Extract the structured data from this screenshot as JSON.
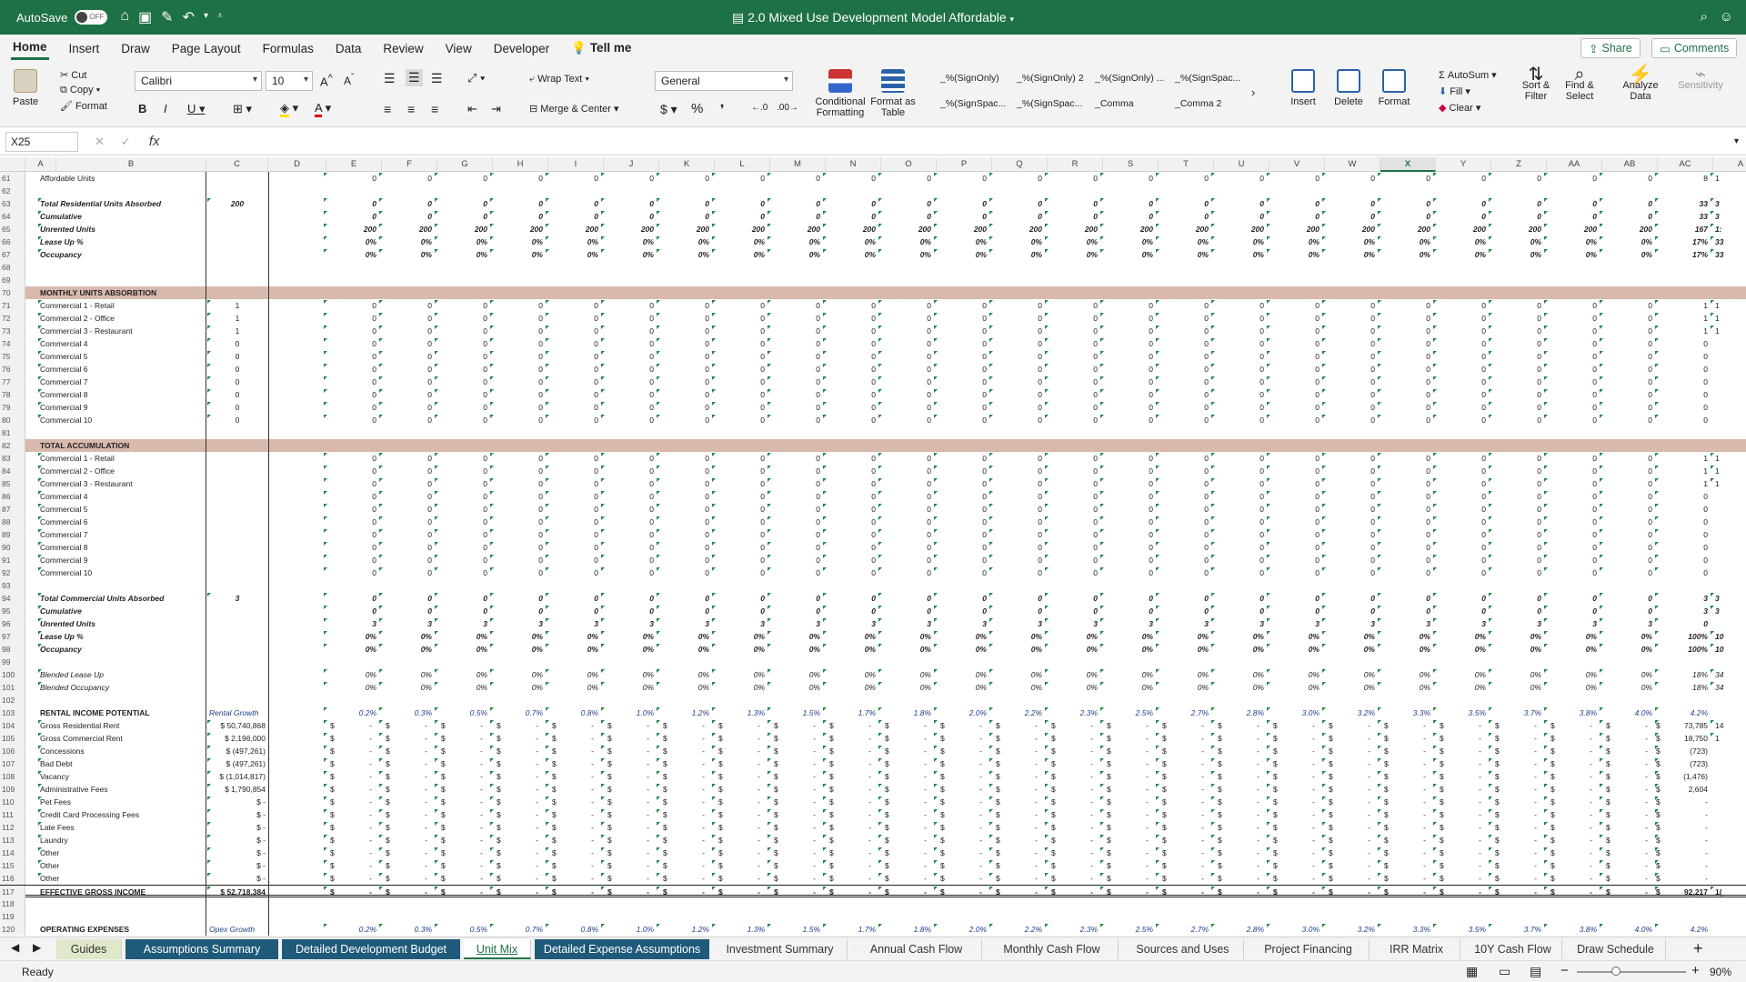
{
  "titlebar": {
    "autosave": "AutoSave",
    "autosave_state": "OFF",
    "title": "2.0 Mixed Use Development Model Affordable"
  },
  "ribbon_tabs": [
    "Home",
    "Insert",
    "Draw",
    "Page Layout",
    "Formulas",
    "Data",
    "Review",
    "View",
    "Developer"
  ],
  "tell_me": "Tell me",
  "share_label": "Share",
  "comments_label": "Comments",
  "ribbon": {
    "paste": "Paste",
    "cut": "Cut",
    "copy": "Copy",
    "format": "Format",
    "font_name": "Calibri",
    "font_size": "10",
    "wrap_text": "Wrap Text",
    "merge_center": "Merge & Center",
    "number_format": "General",
    "conditional_formatting": "Conditional Formatting",
    "format_as_table": "Format as Table",
    "styles": [
      "_%(SignOnly)",
      "_%(SignOnly) 2",
      "_%(SignOnly) ...",
      "_%(SignSpac...",
      "_%(SignSpac...",
      "_%(SignSpac...",
      "_Comma",
      "_Comma 2"
    ],
    "insert": "Insert",
    "delete": "Delete",
    "format_cells": "Format",
    "autosum": "AutoSum",
    "fill": "Fill",
    "clear": "Clear",
    "sort_filter": "Sort & Filter",
    "find_select": "Find & Select",
    "analyze_data": "Analyze Data",
    "sensitivity": "Sensitivity"
  },
  "formula_bar": {
    "name_box": "X25",
    "fx": "fx",
    "content": ""
  },
  "columns": [
    "A",
    "B",
    "C",
    "D",
    "E",
    "F",
    "G",
    "H",
    "I",
    "J",
    "K",
    "L",
    "M",
    "N",
    "O",
    "P",
    "Q",
    "R",
    "S",
    "T",
    "U",
    "V",
    "W",
    "X",
    "Y",
    "Z",
    "AA",
    "AB",
    "AC",
    "A"
  ],
  "selected_column": "X",
  "rows": [
    {
      "n": "61",
      "label": "Affordable Units",
      "c": "",
      "style": "",
      "vals": "0",
      "last": "8"
    },
    {
      "n": "62",
      "label": "",
      "c": "",
      "style": "",
      "vals": "",
      "last": ""
    },
    {
      "n": "63",
      "label": "Total Residential Units Absorbed",
      "c": "200",
      "style": "bi",
      "vals": "0",
      "last": "33"
    },
    {
      "n": "64",
      "label": "Cumulative",
      "c": "",
      "style": "bi",
      "vals": "0",
      "last": "33"
    },
    {
      "n": "65",
      "label": "Unrented Units",
      "c": "",
      "style": "bi",
      "vals": "200",
      "last": "167"
    },
    {
      "n": "66",
      "label": "Lease Up %",
      "c": "",
      "style": "bi",
      "vals": "0%",
      "last": "17%"
    },
    {
      "n": "67",
      "label": "Occupancy",
      "c": "",
      "style": "bi",
      "vals": "0%",
      "last": "17%"
    },
    {
      "n": "68",
      "label": "",
      "c": "",
      "style": "",
      "vals": "",
      "last": ""
    },
    {
      "n": "69",
      "label": "",
      "c": "",
      "style": "",
      "vals": "",
      "last": ""
    },
    {
      "n": "70",
      "label": "MONTHLY UNITS ABSORBTION",
      "c": "",
      "style": "hdr",
      "vals": "",
      "last": ""
    },
    {
      "n": "71",
      "label": "Commercial 1 - Retail",
      "c": "1",
      "style": "",
      "vals": "0",
      "last": "1"
    },
    {
      "n": "72",
      "label": "Commercial 2 - Office",
      "c": "1",
      "style": "",
      "vals": "0",
      "last": "1"
    },
    {
      "n": "73",
      "label": "Commercial 3 - Restaurant",
      "c": "1",
      "style": "",
      "vals": "0",
      "last": "1"
    },
    {
      "n": "74",
      "label": "Commercial 4",
      "c": "0",
      "style": "",
      "vals": "0",
      "last": "0"
    },
    {
      "n": "75",
      "label": "Commercial 5",
      "c": "0",
      "style": "",
      "vals": "0",
      "last": "0"
    },
    {
      "n": "76",
      "label": "Commercial 6",
      "c": "0",
      "style": "",
      "vals": "0",
      "last": "0"
    },
    {
      "n": "77",
      "label": "Commercial 7",
      "c": "0",
      "style": "",
      "vals": "0",
      "last": "0"
    },
    {
      "n": "78",
      "label": "Commercial 8",
      "c": "0",
      "style": "",
      "vals": "0",
      "last": "0"
    },
    {
      "n": "79",
      "label": "Commercial 9",
      "c": "0",
      "style": "",
      "vals": "0",
      "last": "0"
    },
    {
      "n": "80",
      "label": "Commercial 10",
      "c": "0",
      "style": "",
      "vals": "0",
      "last": "0"
    },
    {
      "n": "81",
      "label": "",
      "c": "",
      "style": "",
      "vals": "",
      "last": ""
    },
    {
      "n": "82",
      "label": "TOTAL ACCUMULATION",
      "c": "",
      "style": "hdr",
      "vals": "",
      "last": ""
    },
    {
      "n": "83",
      "label": "Commercial 1 - Retail",
      "c": "",
      "style": "",
      "vals": "0",
      "last": "1"
    },
    {
      "n": "84",
      "label": "Commercial 2 - Office",
      "c": "",
      "style": "",
      "vals": "0",
      "last": "1"
    },
    {
      "n": "85",
      "label": "Commercial 3 - Restaurant",
      "c": "",
      "style": "",
      "vals": "0",
      "last": "1"
    },
    {
      "n": "86",
      "label": "Commercial 4",
      "c": "",
      "style": "",
      "vals": "0",
      "last": "0"
    },
    {
      "n": "87",
      "label": "Commercial 5",
      "c": "",
      "style": "",
      "vals": "0",
      "last": "0"
    },
    {
      "n": "88",
      "label": "Commercial 6",
      "c": "",
      "style": "",
      "vals": "0",
      "last": "0"
    },
    {
      "n": "89",
      "label": "Commercial 7",
      "c": "",
      "style": "",
      "vals": "0",
      "last": "0"
    },
    {
      "n": "90",
      "label": "Commercial 8",
      "c": "",
      "style": "",
      "vals": "0",
      "last": "0"
    },
    {
      "n": "91",
      "label": "Commercial 9",
      "c": "",
      "style": "",
      "vals": "0",
      "last": "0"
    },
    {
      "n": "92",
      "label": "Commercial 10",
      "c": "",
      "style": "",
      "vals": "0",
      "last": "0"
    },
    {
      "n": "93",
      "label": "",
      "c": "",
      "style": "",
      "vals": "",
      "last": ""
    },
    {
      "n": "94",
      "label": "Total Commercial Units Absorbed",
      "c": "3",
      "style": "bi",
      "vals": "0",
      "last": "3"
    },
    {
      "n": "95",
      "label": "Cumulative",
      "c": "",
      "style": "bi",
      "vals": "0",
      "last": "3"
    },
    {
      "n": "96",
      "label": "Unrented Units",
      "c": "",
      "style": "bi",
      "vals": "3",
      "last": "0"
    },
    {
      "n": "97",
      "label": "Lease Up %",
      "c": "",
      "style": "bi",
      "vals": "0%",
      "last": "100%"
    },
    {
      "n": "98",
      "label": "Occupancy",
      "c": "",
      "style": "bi",
      "vals": "0%",
      "last": "100%"
    },
    {
      "n": "99",
      "label": "",
      "c": "",
      "style": "",
      "vals": "",
      "last": ""
    },
    {
      "n": "100",
      "label": "Blended Lease Up",
      "c": "",
      "style": "ital",
      "vals": "0%",
      "last": "18%"
    },
    {
      "n": "101",
      "label": "Blended Occupancy",
      "c": "",
      "style": "ital",
      "vals": "0%",
      "last": "18%"
    },
    {
      "n": "102",
      "label": "",
      "c": "",
      "style": "",
      "vals": "",
      "last": ""
    },
    {
      "n": "103",
      "label": "RENTAL INCOME POTENTIAL",
      "c": "Rental Growth",
      "style": "bold",
      "vals": "growth",
      "last": "4.2%"
    },
    {
      "n": "104",
      "label": "Gross Residential Rent",
      "c": "$ 50,740,868",
      "style": "",
      "vals": "$ -",
      "last": "73,785"
    },
    {
      "n": "105",
      "label": "Gross Commercial Rent",
      "c": "$ 2,196,000",
      "style": "",
      "vals": "$ -",
      "last": "18,750"
    },
    {
      "n": "106",
      "label": "Concessions",
      "c": "$ (497,261)",
      "style": "",
      "vals": "$ -",
      "last": "(723)"
    },
    {
      "n": "107",
      "label": "Bad Debt",
      "c": "$ (497,261)",
      "style": "",
      "vals": "$ -",
      "last": "(723)"
    },
    {
      "n": "108",
      "label": "Vacancy",
      "c": "$ (1,014,817)",
      "style": "",
      "vals": "$ -",
      "last": "(1,476)"
    },
    {
      "n": "109",
      "label": "Administrative Fees",
      "c": "$ 1,790,854",
      "style": "",
      "vals": "$ -",
      "last": "2,604"
    },
    {
      "n": "110",
      "label": "Pet Fees",
      "c": "$ -",
      "style": "",
      "vals": "$ -",
      "last": "-"
    },
    {
      "n": "111",
      "label": "Credit Card Processing Fees",
      "c": "$ -",
      "style": "",
      "vals": "$ -",
      "last": "-"
    },
    {
      "n": "112",
      "label": "Late Fees",
      "c": "$ -",
      "style": "",
      "vals": "$ -",
      "last": "-"
    },
    {
      "n": "113",
      "label": "Laundry",
      "c": "$ -",
      "style": "",
      "vals": "$ -",
      "last": "-"
    },
    {
      "n": "114",
      "label": "Other",
      "c": "$ -",
      "style": "",
      "vals": "$ -",
      "last": "-"
    },
    {
      "n": "115",
      "label": "Other",
      "c": "$ -",
      "style": "",
      "vals": "$ -",
      "last": "-"
    },
    {
      "n": "116",
      "label": "Other",
      "c": "$ -",
      "style": "",
      "vals": "$ -",
      "last": "-"
    },
    {
      "n": "117",
      "label": "EFFECTIVE GROSS INCOME",
      "c": "$ 52,718,384",
      "style": "bold eff",
      "vals": "$ -",
      "last": "92,217"
    },
    {
      "n": "118",
      "label": "",
      "c": "",
      "style": "",
      "vals": "",
      "last": ""
    },
    {
      "n": "119",
      "label": "",
      "c": "",
      "style": "",
      "vals": "",
      "last": ""
    },
    {
      "n": "120",
      "label": "OPERATING EXPENSES",
      "c": "Opex Growth",
      "style": "bold",
      "vals": "growth",
      "last": "4.2%"
    }
  ],
  "growth_values": [
    "0.2%",
    "0.3%",
    "0.5%",
    "0.7%",
    "0.8%",
    "1.0%",
    "1.2%",
    "1.3%",
    "1.5%",
    "1.7%",
    "1.8%",
    "2.0%",
    "2.2%",
    "2.3%",
    "2.5%",
    "2.7%",
    "2.8%",
    "3.0%",
    "3.2%",
    "3.3%",
    "3.5%",
    "3.7%",
    "3.8%",
    "4.0%"
  ],
  "overflow_col": {
    "61": "1",
    "63": "3",
    "64": "3",
    "65": "1:",
    "66": "33",
    "67": "33",
    "71": "1",
    "72": "1",
    "73": "1",
    "83": "1",
    "84": "1",
    "85": "1",
    "94": "3",
    "95": "3",
    "97": "10",
    "98": "10",
    "100": "34",
    "101": "34",
    "104": "14",
    "105": "1",
    "117": "1("
  },
  "sheet_tabs": [
    "Guides",
    "Assumptions Summary",
    "Detailed Development Budget",
    "Unit Mix",
    "Detailed Expense Assumptions",
    "Investment Summary",
    "Annual Cash Flow",
    "Monthly Cash Flow",
    "Sources and Uses",
    "Project Financing",
    "IRR Matrix",
    "10Y Cash Flow",
    "Draw Schedule"
  ],
  "active_sheet": "Unit Mix",
  "status": "Ready",
  "zoom": "90%"
}
